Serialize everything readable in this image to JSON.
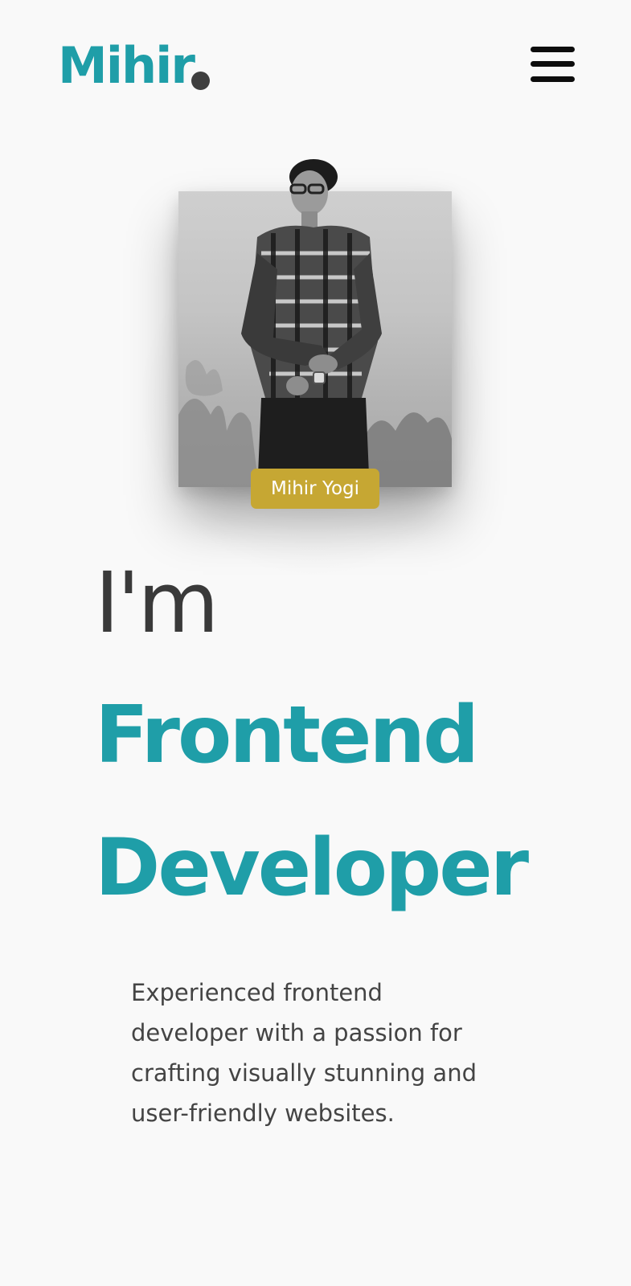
{
  "header": {
    "logo_text": "Mihir",
    "menu_icon": "hamburger-menu-icon"
  },
  "hero": {
    "photo_alt": "Portrait photo",
    "name_badge": "Mihir Yogi",
    "greeting": "I'm",
    "role_line_1": "Frontend",
    "role_line_2": "Developer",
    "description": "Experienced frontend developer with a passion for crafting visually stunning and user-friendly websites."
  },
  "colors": {
    "accent": "#1f9ea8",
    "badge": "#c6a733",
    "background": "#f9f9f9",
    "text": "#3a3a3a"
  }
}
